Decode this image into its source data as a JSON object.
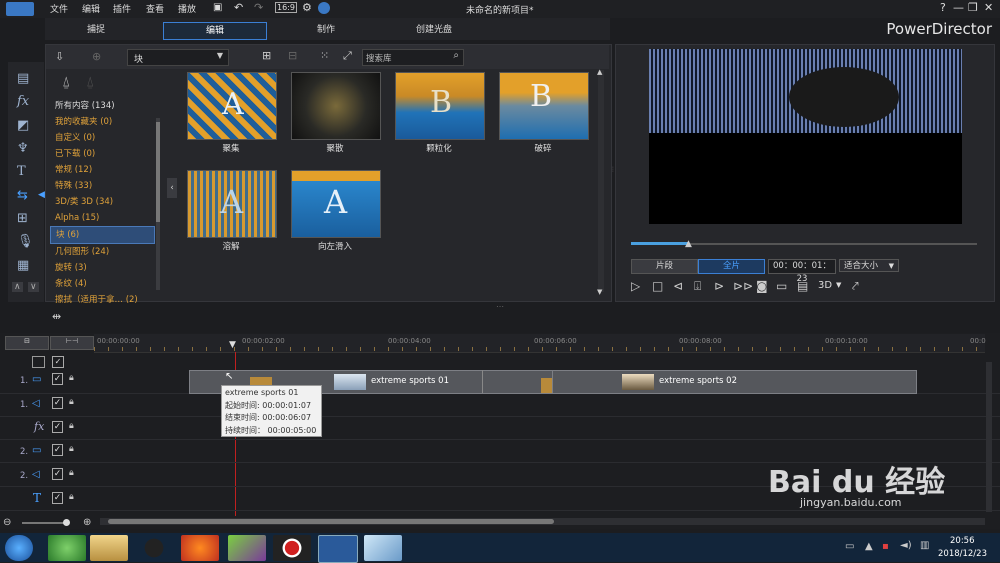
{
  "titlebar": {
    "menus": [
      "文件",
      "编辑",
      "插件",
      "查看",
      "播放"
    ],
    "project_title": "未命名的新项目*",
    "controls": [
      "?",
      "—",
      "❐",
      "✕"
    ]
  },
  "mode_tabs": [
    "捕捉",
    "编辑",
    "制作",
    "创建光盘"
  ],
  "brand": "PowerDirector",
  "library": {
    "dropdown_value": "块",
    "search_placeholder": "搜索库",
    "categories": [
      "所有内容 (134)",
      "我的收藏夹 (0)",
      "自定义 (0)",
      "已下载 (0)",
      "常规 (12)",
      "特殊 (33)",
      "3D/类 3D (34)",
      "Alpha (15)",
      "块 (6)",
      "几何图形 (24)",
      "旋转 (3)",
      "条纹 (4)",
      "擦拭（适用于拿… (2)"
    ],
    "thumbnails": [
      {
        "label": "聚集",
        "letter": "A"
      },
      {
        "label": "聚散",
        "letter": ""
      },
      {
        "label": "颗粒化",
        "letter": "B"
      },
      {
        "label": "破碎",
        "letter": "B"
      },
      {
        "label": "溶解",
        "letter": "A"
      },
      {
        "label": "向左滑入",
        "letter": "A"
      }
    ]
  },
  "preview": {
    "clip_btn": "片段",
    "full_btn": "全片",
    "timecode": "00：00：01：23",
    "fit": "适合大小",
    "mode3d": "3D"
  },
  "timeline": {
    "ruler": [
      "00:00:00:00",
      "00:00:02:00",
      "00:00:04:00",
      "00:00:06:00",
      "00:00:08:00",
      "00:00:10:00",
      "00:0"
    ],
    "tracks": [
      "1.",
      "1.",
      "fx",
      "2.",
      "2.",
      "T"
    ],
    "clips": [
      {
        "name": "extreme sports 01"
      },
      {
        "name": "extreme sports 02"
      }
    ],
    "tooltip": {
      "name": "extreme sports 01",
      "start": "起始时间: 00:00:01:07",
      "end": "结束时间: 00:00:06:07",
      "duration": "持续时间： 00:00:05:00"
    }
  },
  "taskbar": {
    "time": "20:56",
    "date": "2018/12/23"
  },
  "watermark": {
    "brand": "Bai du 经验",
    "url": "jingyan.baidu.com"
  },
  "colors": {
    "accent": "#3b7fd4",
    "category": "#e0a23a"
  }
}
